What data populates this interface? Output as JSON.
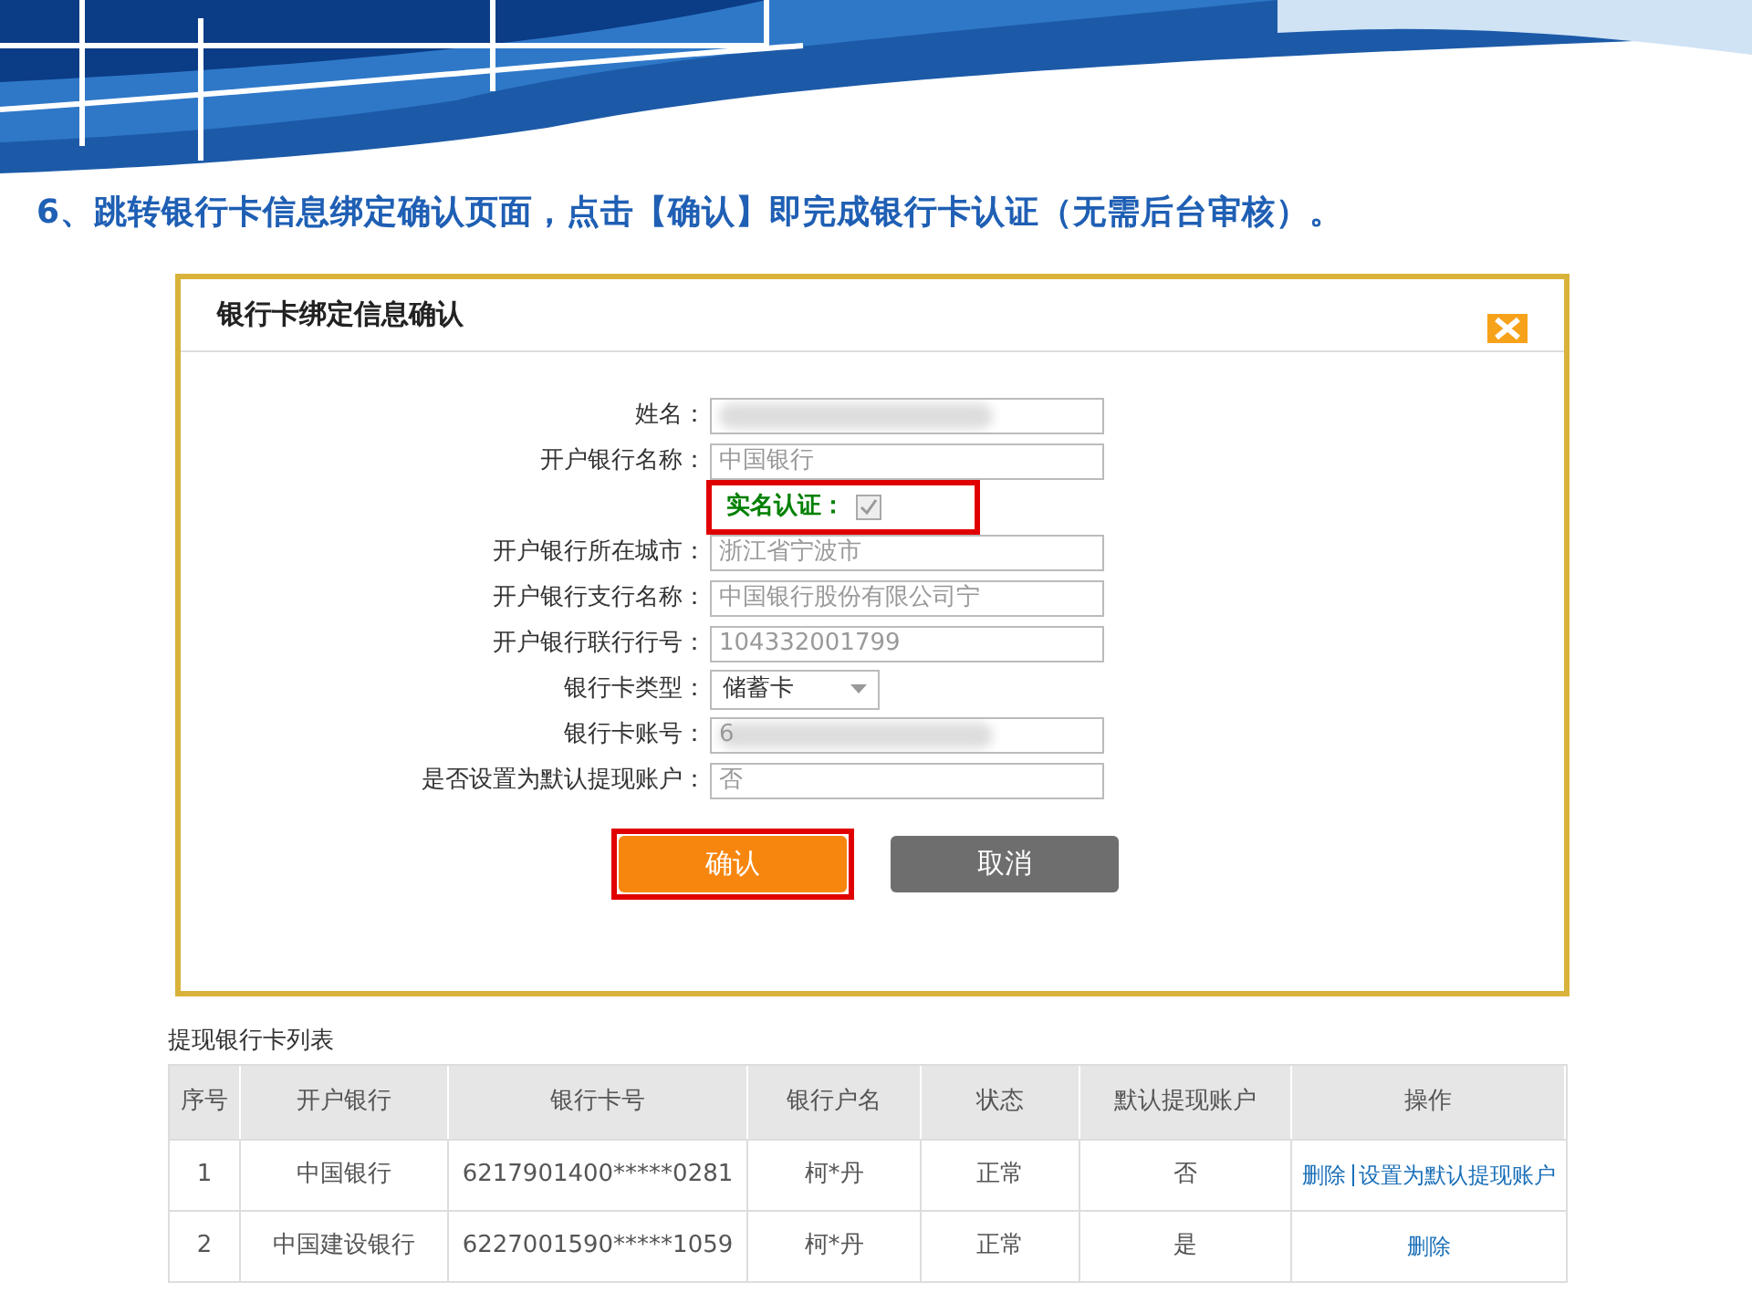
{
  "caption": "6、跳转银行卡信息绑定确认页面，点击【确认】即完成银行卡认证（无需后台审核）。",
  "dialog": {
    "title": "银行卡绑定信息确认",
    "fields": [
      {
        "kind": "text",
        "label": "姓名：",
        "blurred": true,
        "highlighted": false
      },
      {
        "kind": "text",
        "label": "开户银行名称：",
        "value": "中国银行",
        "blurred": false,
        "highlighted": false
      },
      {
        "kind": "checkbox",
        "label": "实名认证：",
        "checked": true,
        "highlighted": true
      },
      {
        "kind": "text",
        "label": "开户银行所在城市：",
        "value": "浙江省宁波市",
        "blurred": false,
        "highlighted": false
      },
      {
        "kind": "text",
        "label": "开户银行支行名称：",
        "value": "中国银行股份有限公司宁",
        "blurred": false,
        "highlighted": false
      },
      {
        "kind": "text",
        "label": "开户银行联行行号：",
        "value": "104332001799",
        "blurred": false,
        "highlighted": false
      },
      {
        "kind": "select",
        "label": "银行卡类型：",
        "value": "储蓄卡",
        "highlighted": false
      },
      {
        "kind": "text",
        "label": "银行卡账号：",
        "value": "6",
        "blurred": true,
        "highlighted": false
      },
      {
        "kind": "text",
        "label": "是否设置为默认提现账户：",
        "value": "否",
        "blurred": false,
        "highlighted": false
      }
    ],
    "buttons": [
      {
        "kind": "primary",
        "label": "确认",
        "highlighted": true
      },
      {
        "kind": "secondary",
        "label": "取消",
        "highlighted": false
      }
    ]
  },
  "card_list": {
    "title": "提现银行卡列表",
    "columns": [
      "序号",
      "开户银行",
      "银行卡号",
      "银行户名",
      "状态",
      "默认提现账户",
      "操作"
    ],
    "rows": [
      {
        "cells": [
          "1",
          "中国银行",
          "6217901400*****0281",
          "柯*丹",
          "正常",
          "否"
        ],
        "actions": [
          "删除",
          "设置为默认提现账户"
        ]
      },
      {
        "cells": [
          "2",
          "中国建设银行",
          "6227001590*****1059",
          "柯*丹",
          "正常",
          "是"
        ],
        "actions": [
          "删除"
        ]
      }
    ]
  }
}
